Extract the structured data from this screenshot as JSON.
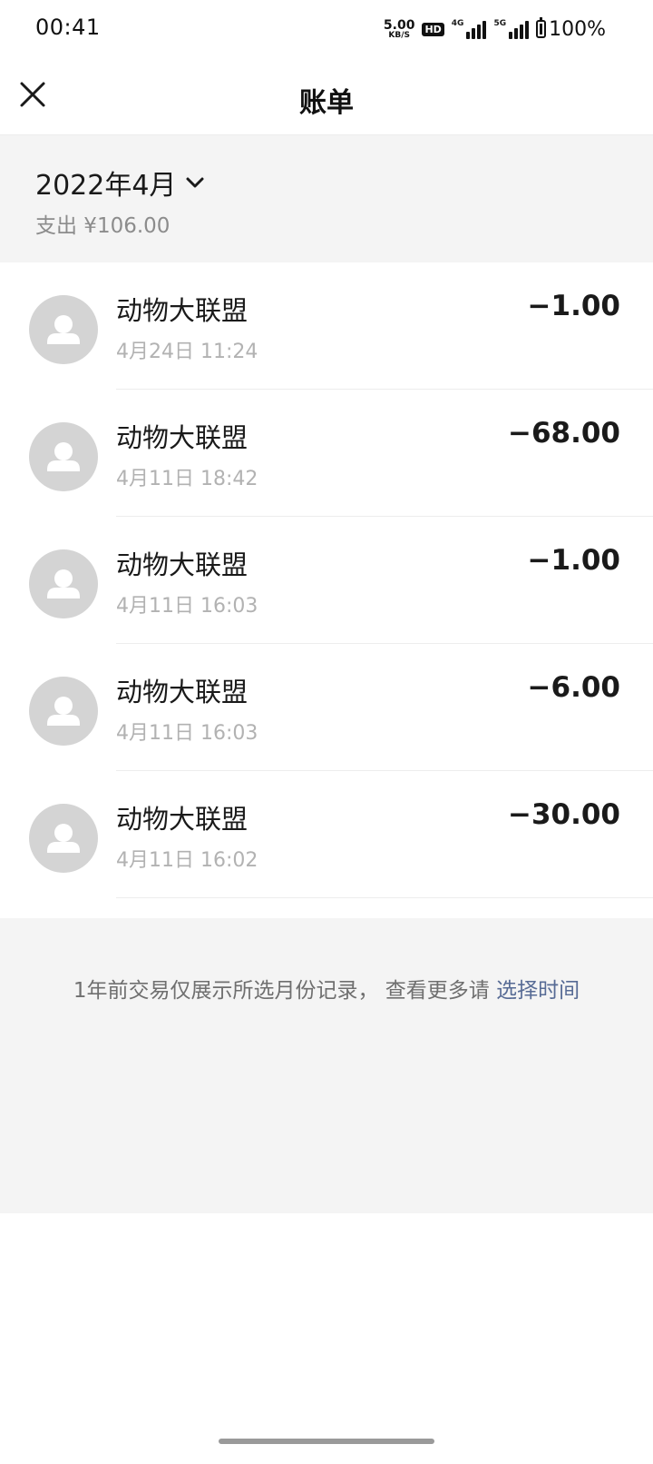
{
  "status_bar": {
    "time": "00:41",
    "net_speed_value": "5.00",
    "net_speed_unit": "KB/S",
    "hd_label": "HD",
    "signal1_label": "4G",
    "signal2_label": "5G",
    "battery": "100%"
  },
  "header": {
    "title": "账单"
  },
  "summary": {
    "month": "2022年4月",
    "total": "支出 ¥106.00"
  },
  "transactions": [
    {
      "name": "动物大联盟",
      "time": "4月24日 11:24",
      "amount": "−1.00"
    },
    {
      "name": "动物大联盟",
      "time": "4月11日 18:42",
      "amount": "−68.00"
    },
    {
      "name": "动物大联盟",
      "time": "4月11日 16:03",
      "amount": "−1.00"
    },
    {
      "name": "动物大联盟",
      "time": "4月11日 16:03",
      "amount": "−6.00"
    },
    {
      "name": "动物大联盟",
      "time": "4月11日 16:02",
      "amount": "−30.00"
    }
  ],
  "footer": {
    "notice": "1年前交易仅展示所选月份记录， 查看更多请 ",
    "link": "选择时间"
  },
  "colors": {
    "link": "#576b95",
    "background_gray": "#f4f4f4",
    "avatar_gray": "#d4d4d4"
  }
}
